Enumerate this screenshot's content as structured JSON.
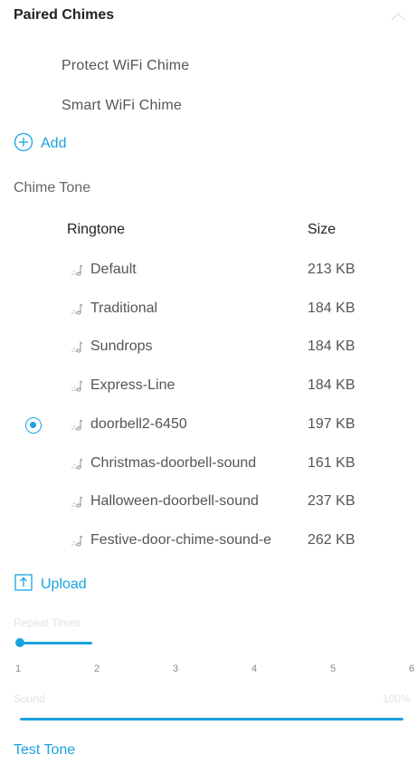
{
  "paired_chimes": {
    "title": "Paired Chimes",
    "items": [
      "Protect WiFi Chime",
      "Smart WiFi Chime"
    ],
    "add_label": "Add"
  },
  "chime_tone": {
    "title": "Chime Tone",
    "columns": {
      "ringtone": "Ringtone",
      "size": "Size"
    },
    "ringtones": [
      {
        "name": "Default",
        "size": "213 KB",
        "selected": false
      },
      {
        "name": "Traditional",
        "size": "184 KB",
        "selected": false
      },
      {
        "name": "Sundrops",
        "size": "184 KB",
        "selected": false
      },
      {
        "name": "Express-Line",
        "size": "184 KB",
        "selected": false
      },
      {
        "name": "doorbell2-6450",
        "size": "197 KB",
        "selected": true
      },
      {
        "name": "Christmas-doorbell-sound",
        "size": "161 KB",
        "selected": false
      },
      {
        "name": "Halloween-doorbell-sound",
        "size": "237 KB",
        "selected": false
      },
      {
        "name": "Festive-door-chime-sound-e",
        "size": "262 KB",
        "selected": false
      }
    ],
    "upload_label": "Upload"
  },
  "repeat_times": {
    "label": "Repeat Times",
    "ticks": [
      "1",
      "2",
      "3",
      "4",
      "5",
      "6"
    ],
    "value": 1
  },
  "sound": {
    "label": "Sound",
    "value_label": "100%",
    "value": 100
  },
  "test_tone_label": "Test Tone",
  "colors": {
    "accent": "#1aa3e0",
    "text": "#555555",
    "faint": "#e3e3e3"
  },
  "icons": {
    "collapse": "chevron-up-icon",
    "add": "plus-circle-icon",
    "ringtone": "music-note-icon",
    "upload": "upload-icon"
  }
}
